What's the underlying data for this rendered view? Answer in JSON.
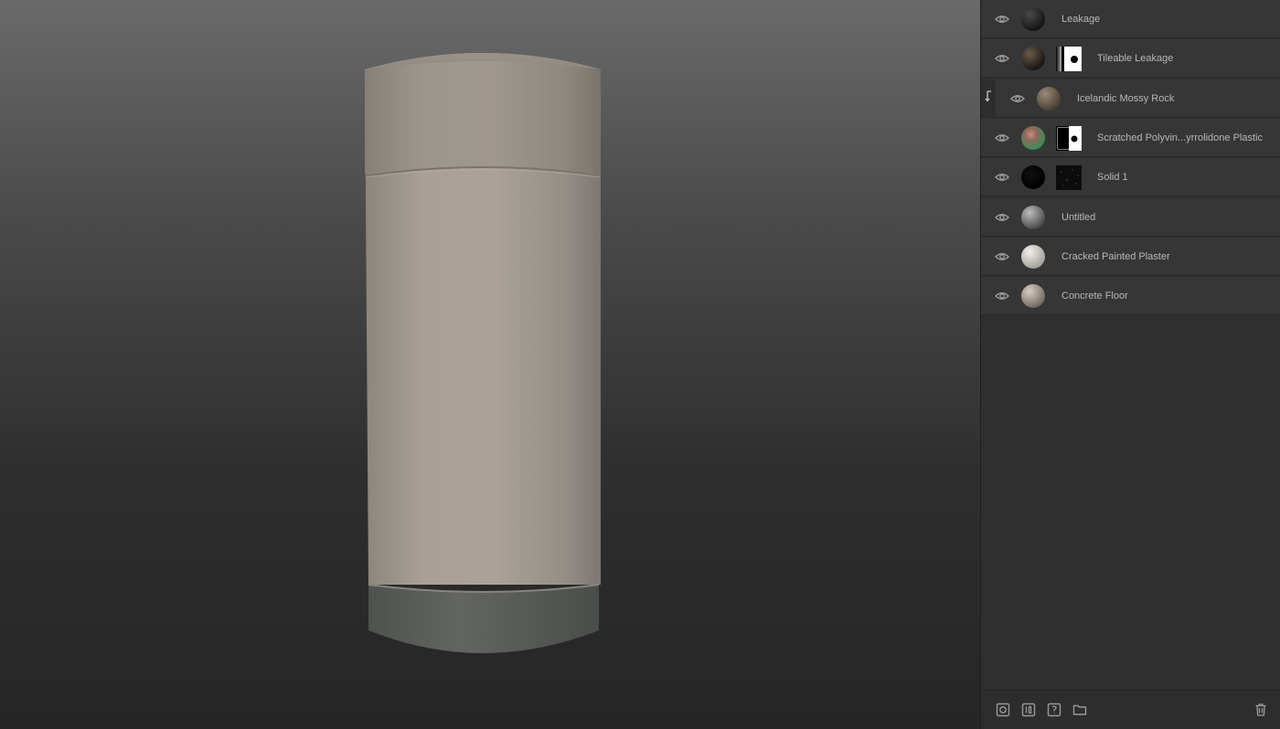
{
  "layers": [
    {
      "name": "Leakage",
      "thumb": "thumb-leakage",
      "mask": null,
      "clipped": false
    },
    {
      "name": "Tileable Leakage",
      "thumb": "thumb-tileable-leakage",
      "mask": "gradient-mask",
      "clipped": false
    },
    {
      "name": "Icelandic Mossy Rock",
      "thumb": "thumb-mossy-rock",
      "mask": null,
      "clipped": true
    },
    {
      "name": "Scratched Polyvin...yrrolidone Plastic",
      "thumb": "thumb-plastic",
      "mask": "halfblack-mask",
      "clipped": false
    },
    {
      "name": "Solid 1",
      "thumb": "thumb-solid",
      "mask": "noise-mask",
      "clipped": false
    },
    {
      "name": "Untitled",
      "thumb": "thumb-untitled",
      "mask": null,
      "clipped": false
    },
    {
      "name": "Cracked Painted Plaster",
      "thumb": "thumb-plaster",
      "mask": null,
      "clipped": false
    },
    {
      "name": "Concrete Floor",
      "thumb": "thumb-concrete",
      "mask": null,
      "clipped": false
    }
  ],
  "toolbar": {
    "icons": [
      "add-material-icon",
      "add-fill-icon",
      "add-paint-icon",
      "add-folder-icon",
      "delete-icon"
    ]
  },
  "colors": {
    "panel_bg": "#2f2f2f",
    "row_bg": "#363636",
    "text": "#b8b8b8",
    "icon": "#9a9a9a"
  }
}
